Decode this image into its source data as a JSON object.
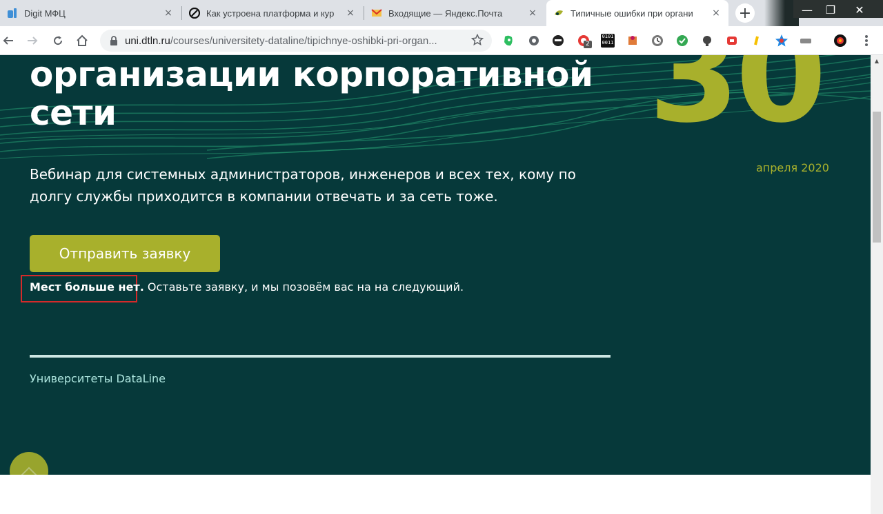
{
  "browser": {
    "tabs": [
      {
        "title": "Digit МФЦ",
        "icon": "digit-favicon",
        "close": "×"
      },
      {
        "title": "Как устроена платформа и кур",
        "icon": "platform-favicon",
        "close": "×"
      },
      {
        "title": "Входящие — Яндекс.Почта",
        "icon": "yandex-mail-favicon",
        "close": "×"
      },
      {
        "title": "Типичные ошибки при органи",
        "icon": "dataline-favicon",
        "close": "×"
      }
    ],
    "new_tab_label": "+",
    "window_controls": {
      "minimize": "—",
      "maximize": "❐",
      "close": "✕"
    },
    "url_host": "uni.dtln.ru",
    "url_path": "/courses/universitety-dataline/tipichnye-oshibki-pri-organ...",
    "ext_badge": "2",
    "ext_binary_top": "0101",
    "ext_binary_bottom": "0011"
  },
  "hero": {
    "title_line1": "организации корпоративной",
    "title_line2": "сети",
    "date_day": "30",
    "date_month": "апреля 2020",
    "subtitle": "Вебинар для системных администраторов, инженеров и всех тех, кому по долгу службы приходится в компании отвечать и за сеть тоже.",
    "cta_label": "Отправить заявку",
    "notice_bold": "Мест больше нет.",
    "notice_rest": " Оставьте заявку, и мы позовём вас на на следующий.",
    "footer_link": "Университеты DataLine"
  },
  "colors": {
    "page_bg": "#06393a",
    "accent": "#a8b02c",
    "highlight_border": "#d42a2a"
  }
}
